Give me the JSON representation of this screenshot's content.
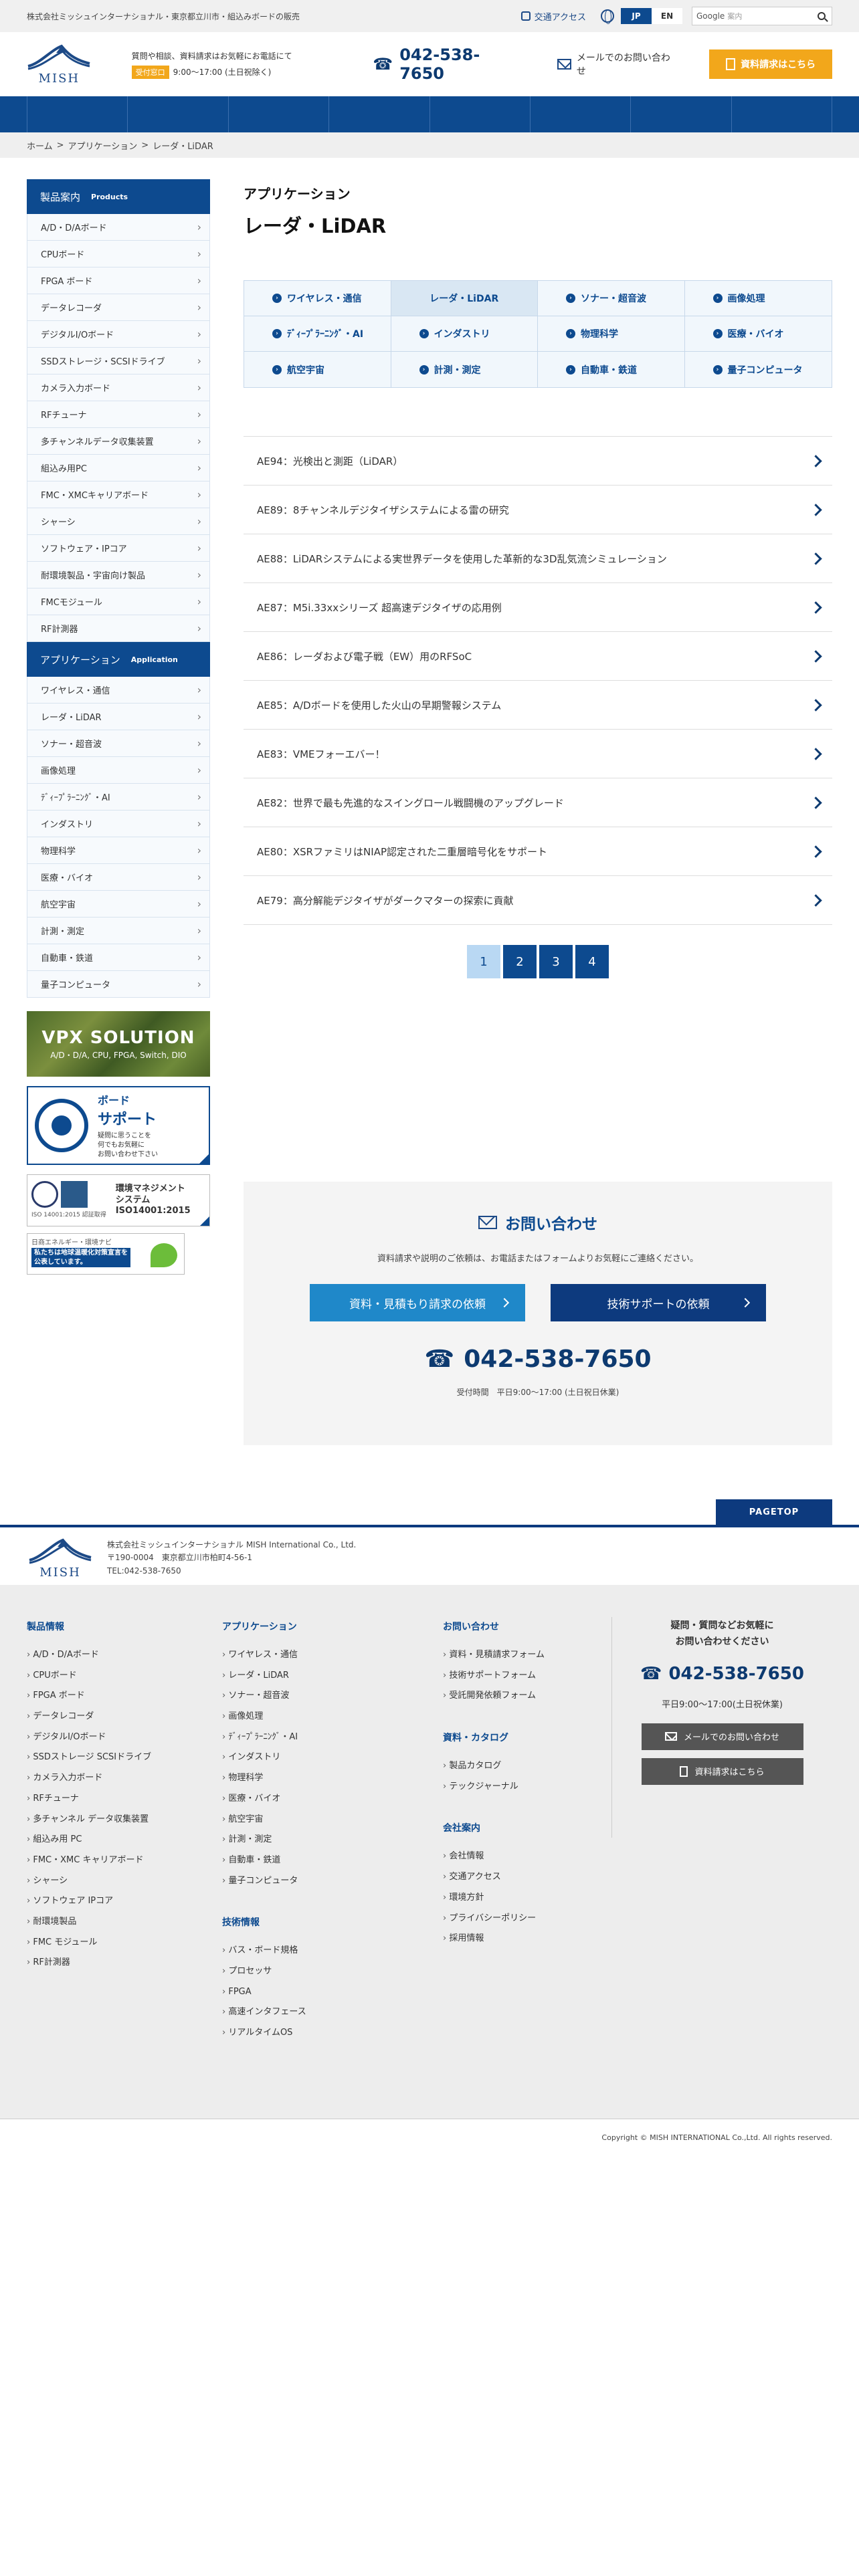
{
  "topbar": {
    "company": "株式会社ミッシュインターナショナル・東京都立川市・組込みボードの販売",
    "access": "交通アクセス",
    "lang_jp": "JP",
    "lang_en": "EN",
    "search_brand": "Google",
    "search_placeholder": "案内"
  },
  "header": {
    "logo_text": "MISH",
    "info_line": "質問や相談、資料請求はお気軽にお電話にて",
    "hours_badge": "受付窓口",
    "hours": "9:00〜17:00 (土日祝除く)",
    "phone": "042-538-7650",
    "mail_label": "メールでのお問い合わせ",
    "request_label": "資料請求はこちら"
  },
  "breadcrumb": [
    "ホーム",
    ">",
    "アプリケーション",
    ">",
    "レーダ・LiDAR"
  ],
  "sidebar": {
    "products_title": "製品案内",
    "products_sub": "Products",
    "products": [
      "A/D・D/Aボード",
      "CPUボード",
      "FPGA ボード",
      "データレコーダ",
      "デジタルI/Oボード",
      "SSDストレージ・SCSIドライブ",
      "カメラ入力ボード",
      "RFチューナ",
      "多チャンネルデータ収集装置",
      "組込み用PC",
      "FMC・XMCキャリアボード",
      "シャーシ",
      "ソフトウェア・IPコア",
      "耐環境製品・宇宙向け製品",
      "FMCモジュール",
      "RF計測器"
    ],
    "apps_title": "アプリケーション",
    "apps_sub": "Application",
    "apps": [
      "ワイヤレス・通信",
      "レーダ・LiDAR",
      "ソナー・超音波",
      "画像処理",
      "ﾃﾞｨｰﾌﾟﾗｰﾆﾝｸﾞ・AI",
      "インダストリ",
      "物理科学",
      "医療・バイオ",
      "航空宇宙",
      "計測・測定",
      "自動車・鉄道",
      "量子コンピュータ"
    ],
    "vpx_title": "VPX SOLUTION",
    "vpx_sub": "A/D・D/A, CPU, FPGA, Switch, DIO",
    "support_l1": "ボード",
    "support_l2": "サポート",
    "support_l3": "疑問に思うことを\n何でもお気軽に\nお問い合わせ下さい",
    "iso_l1": "環境マネジメント",
    "iso_l2": "システム",
    "iso_l3": "ISO14001:2015",
    "iso_small": "ISO 14001:2015 認証取得",
    "eco_l1": "日商エネルギー・環境ナビ",
    "eco_l2": "私たちは地球温暖化対策宣言を",
    "eco_l3": "公表しています。"
  },
  "main": {
    "category": "アプリケーション",
    "title": "レーダ・LiDAR",
    "app_tabs": [
      "ワイヤレス・通信",
      "レーダ・LiDAR",
      "ソナー・超音波",
      "画像処理",
      "ﾃﾞｨｰﾌﾟﾗｰﾆﾝｸﾞ・AI",
      "インダストリ",
      "物理科学",
      "医療・バイオ",
      "航空宇宙",
      "計測・測定",
      "自動車・鉄道",
      "量子コンピュータ"
    ],
    "articles": [
      "AE94：光検出と測距（LiDAR）",
      "AE89：8チャンネルデジタイザシステムによる雷の研究",
      "AE88：LiDARシステムによる実世界データを使用した革新的な3D乱気流シミュレーション",
      "AE87：M5i.33xxシリーズ 超高速デジタイザの応用例",
      "AE86：レーダおよび電子戦（EW）用のRFSoC",
      "AE85：A/Dボードを使用した火山の早期警報システム",
      "AE83：VMEフォーエバー！",
      "AE82：世界で最も先進的なスイングロール戦闘機のアップグレード",
      "AE80：XSRファミリはNIAP認定された二重層暗号化をサポート",
      "AE79：高分解能デジタイザがダークマターの探索に貢献"
    ],
    "pages": [
      "1",
      "2",
      "3",
      "4"
    ]
  },
  "contact": {
    "title": "お問い合わせ",
    "desc": "資料請求や説明のご依頼は、お電話またはフォームよりお気軽にご連絡ください。",
    "btn_quote": "資料・見積もり請求の依頼",
    "btn_support": "技術サポートの依頼",
    "phone": "042-538-7650",
    "hours": "受付時間　平日9:00〜17:00 (土日祝日休業)"
  },
  "footer": {
    "pagetop": "PAGETOP",
    "company": "株式会社ミッシュインターナショナル MISH International Co., Ltd.",
    "address": "〒190-0004　東京都立川市柏町4-56-1",
    "tel": "TEL:042-538-7650",
    "col_products_title": "製品情報",
    "col_products": [
      "A/D・D/Aボード",
      "CPUボード",
      "FPGA ボード",
      "データレコーダ",
      "デジタルI/Oボード",
      "SSDストレージ SCSIドライブ",
      "カメラ入力ボード",
      "RFチューナ",
      "多チャンネル データ収集装置",
      "組込み用 PC",
      "FMC・XMC キャリアボード",
      "シャーシ",
      "ソフトウェア IPコア",
      "耐環境製品",
      "FMC モジュール",
      "RF計測器"
    ],
    "col_apps_title": "アプリケーション",
    "col_apps": [
      "ワイヤレス・通信",
      "レーダ・LiDAR",
      "ソナー・超音波",
      "画像処理",
      "ﾃﾞｨｰﾌﾟﾗｰﾆﾝｸﾞ・AI",
      "インダストリ",
      "物理科学",
      "医療・バイオ",
      "航空宇宙",
      "計測・測定",
      "自動車・鉄道",
      "量子コンピュータ"
    ],
    "col_tech_title": "技術情報",
    "col_tech": [
      "バス・ボード規格",
      "プロセッサ",
      "FPGA",
      "高速インタフェース",
      "リアルタイムOS"
    ],
    "col_inq_title": "お問い合わせ",
    "col_inq": [
      "資料・見積請求フォーム",
      "技術サポートフォーム",
      "受託開発依頼フォーム"
    ],
    "col_cat_title": "資料・カタログ",
    "col_cat": [
      "製品カタログ",
      "テックジャーナル"
    ],
    "col_co_title": "会社案内",
    "col_co": [
      "会社情報",
      "交通アクセス",
      "環境方針",
      "プライバシーポリシー",
      "採用情報"
    ],
    "contact_q1": "疑問・質問などお気軽に",
    "contact_q2": "お問い合わせください",
    "phone": "042-538-7650",
    "hours": "平日9:00〜17:00(土日祝休業)",
    "mail_btn": "メールでのお問い合わせ",
    "req_btn": "資料請求はこちら",
    "copyright": "Copyright © MISH INTERNATIONAL Co.,Ltd. All rights reserved."
  },
  "colors": {
    "primary": "#0d4a8f",
    "accent": "#f2a71b",
    "light": "#f1f7fc"
  }
}
